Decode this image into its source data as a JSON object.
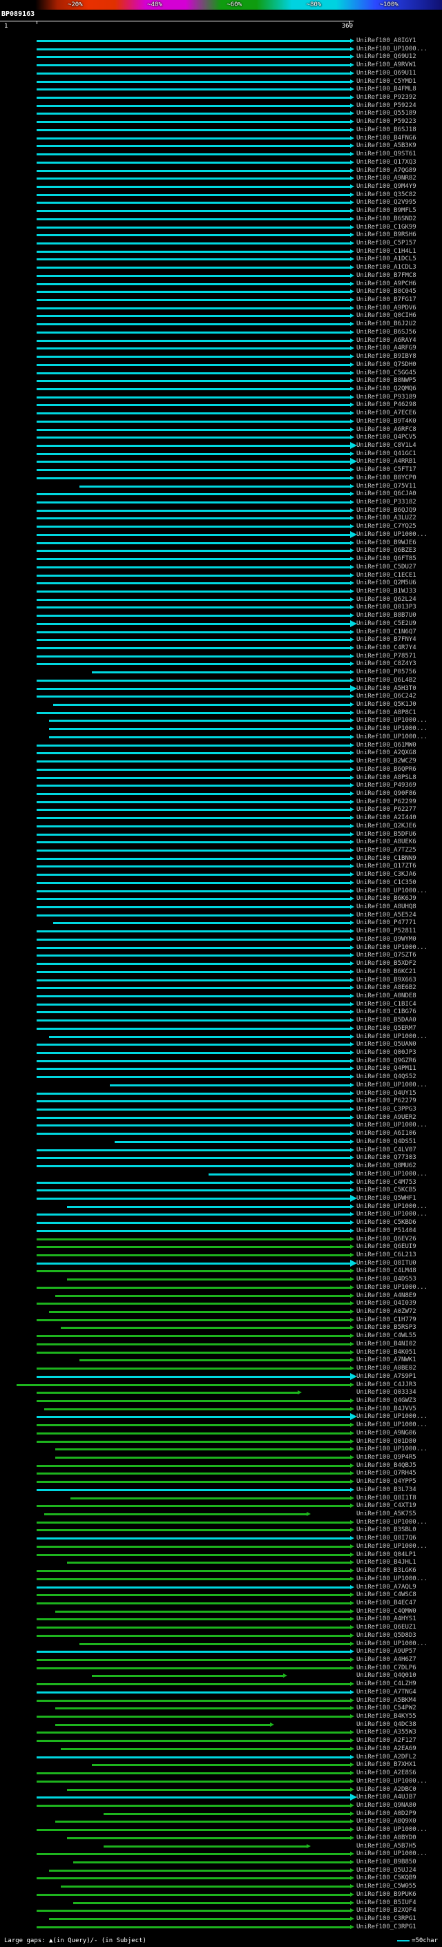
{
  "scalebar": {
    "labels": [
      "~20%",
      "~40%",
      "~60%",
      "~80%",
      "~100%"
    ]
  },
  "query": {
    "name": "BP089163",
    "start_label": "1",
    "end_label": "360",
    "length": 360
  },
  "legend": {
    "gaps_label": "Large gaps: ▲(in Query)/- (in Subject)",
    "scale_label": "=50char"
  },
  "colors": {
    "c": "#00d8e0",
    "g": "#1db41d"
  },
  "hits": [
    [
      "UniRef100_A8IGY1",
      "c"
    ],
    [
      "UniRef100_UP1000...",
      "c"
    ],
    [
      "UniRef100_Q69U12",
      "c"
    ],
    [
      "UniRef100_A9RVW1",
      "c"
    ],
    [
      "UniRef100_Q69U11",
      "c"
    ],
    [
      "UniRef100_C5YMD1",
      "c"
    ],
    [
      "UniRef100_B4FML8",
      "c"
    ],
    [
      "UniRef100_P92392",
      "c"
    ],
    [
      "UniRef100_P59224",
      "c"
    ],
    [
      "UniRef100_Q55189",
      "c"
    ],
    [
      "UniRef100_P59223",
      "c"
    ],
    [
      "UniRef100_B6SJ18",
      "c"
    ],
    [
      "UniRef100_B4FNG6",
      "c"
    ],
    [
      "UniRef100_A5B3K9",
      "c"
    ],
    [
      "UniRef100_Q9ST61",
      "c"
    ],
    [
      "UniRef100_Q17XQ3",
      "c"
    ],
    [
      "UniRef100_A7QG89",
      "c"
    ],
    [
      "UniRef100_A9NR82",
      "c"
    ],
    [
      "UniRef100_Q9M4Y9",
      "c"
    ],
    [
      "UniRef100_Q35C82",
      "c"
    ],
    [
      "UniRef100_Q2V995",
      "c"
    ],
    [
      "UniRef100_B9MFL5",
      "c"
    ],
    [
      "UniRef100_B6SND2",
      "c"
    ],
    [
      "UniRef100_C1GK99",
      "c"
    ],
    [
      "UniRef100_B9RSH6",
      "c"
    ],
    [
      "UniRef100_C5P157",
      "c"
    ],
    [
      "UniRef100_C1H4L1",
      "c"
    ],
    [
      "UniRef100_A1DCL5",
      "c"
    ],
    [
      "UniRef100_A1CDL3",
      "c"
    ],
    [
      "UniRef100_B7FMC8",
      "c"
    ],
    [
      "UniRef100_A9PCH6",
      "c"
    ],
    [
      "UniRef100_B8C045",
      "c"
    ],
    [
      "UniRef100_B7FG17",
      "c"
    ],
    [
      "UniRef100_A9PDV6",
      "c"
    ],
    [
      "UniRef100_Q0CIH6",
      "c"
    ],
    [
      "UniRef100_B6J2U2",
      "c"
    ],
    [
      "UniRef100_B6SJ56",
      "c"
    ],
    [
      "UniRef100_A6RAY4",
      "c"
    ],
    [
      "UniRef100_A4RFG9",
      "c"
    ],
    [
      "UniRef100_B9IBY8",
      "c"
    ],
    [
      "UniRef100_Q7SDH0",
      "c"
    ],
    [
      "UniRef100_C5GG45",
      "c"
    ],
    [
      "UniRef100_B8NWP5",
      "c"
    ],
    [
      "UniRef100_Q2QMQ6",
      "c"
    ],
    [
      "UniRef100_P93189",
      "c"
    ],
    [
      "UniRef100_P46298",
      "c"
    ],
    [
      "UniRef100_A7ECE6",
      "c"
    ],
    [
      "UniRef100_B9T4K0",
      "c"
    ],
    [
      "UniRef100_A6RFC8",
      "c"
    ],
    [
      "UniRef100_Q4PCV5",
      "c"
    ],
    [
      "UniRef100_C8V1L4",
      "c",
      1,
      360,
      1
    ],
    [
      "UniRef100_Q41GC1",
      "c"
    ],
    [
      "UniRef100_A4RRB1",
      "c",
      1,
      360,
      1
    ],
    [
      "UniRef100_C5FT17",
      "c"
    ],
    [
      "UniRef100_B0YCP0",
      "c"
    ],
    [
      "UniRef100_Q75V11",
      "c",
      50
    ],
    [
      "UniRef100_Q6CJA0",
      "c"
    ],
    [
      "UniRef100_P33182",
      "c"
    ],
    [
      "UniRef100_B6QJQ9",
      "c"
    ],
    [
      "UniRef100_A3LUZ2",
      "c"
    ],
    [
      "UniRef100_C7YQ25",
      "c"
    ],
    [
      "UniRef100_UP1000...",
      "c",
      1,
      360,
      1
    ],
    [
      "UniRef100_B9WJE6",
      "c"
    ],
    [
      "UniRef100_Q6BZE3",
      "c"
    ],
    [
      "UniRef100_Q6FT85",
      "c"
    ],
    [
      "UniRef100_C5DU27",
      "c"
    ],
    [
      "UniRef100_C1ECE1",
      "c"
    ],
    [
      "UniRef100_Q2M5U6",
      "c"
    ],
    [
      "UniRef100_B1WJ33",
      "c"
    ],
    [
      "UniRef100_Q62L24",
      "c"
    ],
    [
      "UniRef100_Q013P3",
      "c"
    ],
    [
      "UniRef100_B8B7U0",
      "c"
    ],
    [
      "UniRef100_C5E2U9",
      "c",
      1,
      360,
      1
    ],
    [
      "UniRef100_C1N6Q7",
      "c"
    ],
    [
      "UniRef100_B7FNY4",
      "c"
    ],
    [
      "UniRef100_C4R7Y4",
      "c"
    ],
    [
      "UniRef100_P78571",
      "c"
    ],
    [
      "UniRef100_C8Z4Y3",
      "c"
    ],
    [
      "UniRef100_P05756",
      "c",
      64
    ],
    [
      "UniRef100_Q6L4B2",
      "c"
    ],
    [
      "UniRef100_A5H3T0",
      "c",
      1,
      360,
      1
    ],
    [
      "UniRef100_Q6C242",
      "c"
    ],
    [
      "UniRef100_Q5K1J0",
      "c",
      20
    ],
    [
      "UniRef100_A8P8C1",
      "c"
    ],
    [
      "UniRef100_UP1000...",
      "c",
      15
    ],
    [
      "UniRef100_UP1000...",
      "c",
      15
    ],
    [
      "UniRef100_UP1000...",
      "c",
      15
    ],
    [
      "UniRef100_Q61MW0",
      "c"
    ],
    [
      "UniRef100_A2QXG8",
      "c"
    ],
    [
      "UniRef100_B2WCZ9",
      "c"
    ],
    [
      "UniRef100_B6QPR6",
      "c"
    ],
    [
      "UniRef100_A8PSL8",
      "c"
    ],
    [
      "UniRef100_P49369",
      "c"
    ],
    [
      "UniRef100_Q90F86",
      "c"
    ],
    [
      "UniRef100_P62299",
      "c"
    ],
    [
      "UniRef100_P62277",
      "c"
    ],
    [
      "UniRef100_A2I440",
      "c"
    ],
    [
      "UniRef100_Q2KJE6",
      "c"
    ],
    [
      "UniRef100_B5DFU6",
      "c"
    ],
    [
      "UniRef100_A8UEK6",
      "c"
    ],
    [
      "UniRef100_A7TZ25",
      "c"
    ],
    [
      "UniRef100_C1BNN9",
      "c"
    ],
    [
      "UniRef100_Q17ZT6",
      "c"
    ],
    [
      "UniRef100_C3KJA6",
      "c"
    ],
    [
      "UniRef100_C1C350",
      "c"
    ],
    [
      "UniRef100_UP1000...",
      "c"
    ],
    [
      "UniRef100_B6K6J9",
      "c"
    ],
    [
      "UniRef100_A8UHQ8",
      "c"
    ],
    [
      "UniRef100_A5E524",
      "c"
    ],
    [
      "UniRef100_P47771",
      "c",
      20
    ],
    [
      "UniRef100_P52811",
      "c"
    ],
    [
      "UniRef100_Q9WYM0",
      "c"
    ],
    [
      "UniRef100_UP1000...",
      "c"
    ],
    [
      "UniRef100_Q7SZT6",
      "c"
    ],
    [
      "UniRef100_B5XDF2",
      "c"
    ],
    [
      "UniRef100_B6KC21",
      "c"
    ],
    [
      "UniRef100_B9X663",
      "c"
    ],
    [
      "UniRef100_A8E6B2",
      "c"
    ],
    [
      "UniRef100_A0NDE8",
      "c"
    ],
    [
      "UniRef100_C1BIC4",
      "c"
    ],
    [
      "UniRef100_C1BG76",
      "c"
    ],
    [
      "UniRef100_B5DAA0",
      "c"
    ],
    [
      "UniRef100_Q5ERM7",
      "c"
    ],
    [
      "UniRef100_UP1000...",
      "c",
      15
    ],
    [
      "UniRef100_Q5UAN0",
      "c"
    ],
    [
      "UniRef100_Q00JP3",
      "c"
    ],
    [
      "UniRef100_Q9GZR6",
      "c"
    ],
    [
      "UniRef100_Q4PM11",
      "c"
    ],
    [
      "UniRef100_Q4QS52",
      "c"
    ],
    [
      "UniRef100_UP1000...",
      "c",
      85
    ],
    [
      "UniRef100_Q4UY15",
      "c"
    ],
    [
      "UniRef100_P62279",
      "c"
    ],
    [
      "UniRef100_C3PPG3",
      "c"
    ],
    [
      "UniRef100_A9UER2",
      "c"
    ],
    [
      "UniRef100_UP1000...",
      "c"
    ],
    [
      "UniRef100_A6I106",
      "c"
    ],
    [
      "UniRef100_Q4DS51",
      "c",
      90
    ],
    [
      "UniRef100_C4LV07",
      "c"
    ],
    [
      "UniRef100_Q77303",
      "c"
    ],
    [
      "UniRef100_Q8MU62",
      "c"
    ],
    [
      "UniRef100_UP1000...",
      "c",
      198
    ],
    [
      "UniRef100_C4M753",
      "c"
    ],
    [
      "UniRef100_C5KCB5",
      "c"
    ],
    [
      "UniRef100_Q5WHF1",
      "c",
      1,
      360,
      1
    ],
    [
      "UniRef100_UP1000...",
      "c",
      36
    ],
    [
      "UniRef100_UP1000...",
      "c"
    ],
    [
      "UniRef100_C5KBD6",
      "c"
    ],
    [
      "UniRef100_P51404",
      "c"
    ],
    [
      "UniRef100_Q6EV26",
      "g"
    ],
    [
      "UniRef100_Q6EUI9",
      "g"
    ],
    [
      "UniRef100_C6L213",
      "g"
    ],
    [
      "UniRef100_Q8ITU0",
      "c",
      1,
      360,
      1
    ],
    [
      "UniRef100_C4LM48",
      "g"
    ],
    [
      "UniRef100_Q4DS53",
      "g",
      36
    ],
    [
      "UniRef100_UP1000...",
      "g"
    ],
    [
      "UniRef100_A4N8E9",
      "g",
      22
    ],
    [
      "UniRef100_Q4I039",
      "g"
    ],
    [
      "UniRef100_A0ZW72",
      "g",
      15
    ],
    [
      "UniRef100_C1H779",
      "g"
    ],
    [
      "UniRef100_B5RSP3",
      "g",
      29
    ],
    [
      "UniRef100_C4WL55",
      "g"
    ],
    [
      "UniRef100_B4NI02",
      "g"
    ],
    [
      "UniRef100_B4K051",
      "g"
    ],
    [
      "UniRef100_A7NWK1",
      "g",
      50
    ],
    [
      "UniRef100_A0BE02",
      "g"
    ],
    [
      "UniRef100_A7S9P1",
      "c",
      1,
      360,
      1
    ],
    [
      "UniRef100_C4JJR3",
      "g",
      -22
    ],
    [
      "UniRef100_Q03334",
      "g",
      1,
      300
    ],
    [
      "UniRef100_Q4GWZ3",
      "g"
    ],
    [
      "UniRef100_B4JVV5",
      "g",
      10
    ],
    [
      "UniRef100_UP1000...",
      "c",
      1,
      360,
      1
    ],
    [
      "UniRef100_UP1000...",
      "g"
    ],
    [
      "UniRef100_A9NG06",
      "g"
    ],
    [
      "UniRef100_Q01D80",
      "g"
    ],
    [
      "UniRef100_UP1000...",
      "g",
      22
    ],
    [
      "UniRef100_Q9P4R5",
      "g",
      22
    ],
    [
      "UniRef100_B4QBJ5",
      "g"
    ],
    [
      "UniRef100_Q7RH45",
      "g"
    ],
    [
      "UniRef100_Q4YPP5",
      "g"
    ],
    [
      "UniRef100_B3L734",
      "c"
    ],
    [
      "UniRef100_Q8I1T8",
      "g",
      40
    ],
    [
      "UniRef100_C4XT19",
      "g"
    ],
    [
      "UniRef100_A5K7S5",
      "g",
      10,
      310
    ],
    [
      "UniRef100_UP1000...",
      "g"
    ],
    [
      "UniRef100_B3SBL0",
      "g"
    ],
    [
      "UniRef100_Q8I7Q6",
      "c"
    ],
    [
      "UniRef100_UP1000...",
      "g"
    ],
    [
      "UniRef100_Q04LP1",
      "g"
    ],
    [
      "UniRef100_B4JHL1",
      "g",
      36
    ],
    [
      "UniRef100_B3LGK6",
      "g"
    ],
    [
      "UniRef100_UP1000...",
      "g"
    ],
    [
      "UniRef100_A7AQL9",
      "c"
    ],
    [
      "UniRef100_C4WSC8",
      "g"
    ],
    [
      "UniRef100_B4EC47",
      "g"
    ],
    [
      "UniRef100_C4QMW0",
      "g",
      22
    ],
    [
      "UniRef100_A4HYS1",
      "g"
    ],
    [
      "UniRef100_Q6EUZ1",
      "g"
    ],
    [
      "UniRef100_Q5D8D3",
      "g"
    ],
    [
      "UniRef100_UP1000...",
      "g",
      50
    ],
    [
      "UniRef100_A9UP57",
      "c"
    ],
    [
      "UniRef100_A4H6Z7",
      "g"
    ],
    [
      "UniRef100_C7DLP6",
      "g"
    ],
    [
      "UniRef100_Q4Q010",
      "g",
      64,
      283
    ],
    [
      "UniRef100_C4LZH9",
      "g"
    ],
    [
      "UniRef100_A7TNG4",
      "c"
    ],
    [
      "UniRef100_A5BKM4",
      "g"
    ],
    [
      "UniRef100_C54PW2",
      "g",
      22
    ],
    [
      "UniRef100_B4KY55",
      "g"
    ],
    [
      "UniRef100_Q4DC38",
      "g",
      22,
      268
    ],
    [
      "UniRef100_A355W3",
      "g"
    ],
    [
      "UniRef100_A2F127",
      "g"
    ],
    [
      "UniRef100_A2EA69",
      "g",
      29
    ],
    [
      "UniRef100_A2DFL2",
      "c"
    ],
    [
      "UniRef100_B7XHX1",
      "g",
      64
    ],
    [
      "UniRef100_A2E8S6",
      "g"
    ],
    [
      "UniRef100_UP1000...",
      "g"
    ],
    [
      "UniRef100_A2DBC0",
      "g",
      36
    ],
    [
      "UniRef100_A4UJB7",
      "c",
      1,
      360,
      1
    ],
    [
      "UniRef100_Q9NA80",
      "g"
    ],
    [
      "UniRef100_A0D2P9",
      "g",
      78
    ],
    [
      "UniRef100_A8Q9X0",
      "g",
      22
    ],
    [
      "UniRef100_UP1000...",
      "g"
    ],
    [
      "UniRef100_A0BYD0",
      "g",
      36
    ],
    [
      "UniRef100_A5B7H5",
      "g",
      78,
      310
    ],
    [
      "UniRef100_UP1000...",
      "g"
    ],
    [
      "UniRef100_B9B850",
      "g",
      43
    ],
    [
      "UniRef100_Q5UJ24",
      "g",
      15
    ],
    [
      "UniRef100_C5KQB9",
      "g"
    ],
    [
      "UniRef100_C5W055",
      "g",
      29
    ],
    [
      "UniRef100_B9PUK6",
      "g"
    ],
    [
      "UniRef100_B5IUF4",
      "g",
      43
    ],
    [
      "UniRef100_B2XQF4",
      "g"
    ],
    [
      "UniRef100_C3RPG1",
      "g",
      15
    ],
    [
      "UniRef100_C3RPG1",
      "g"
    ]
  ]
}
